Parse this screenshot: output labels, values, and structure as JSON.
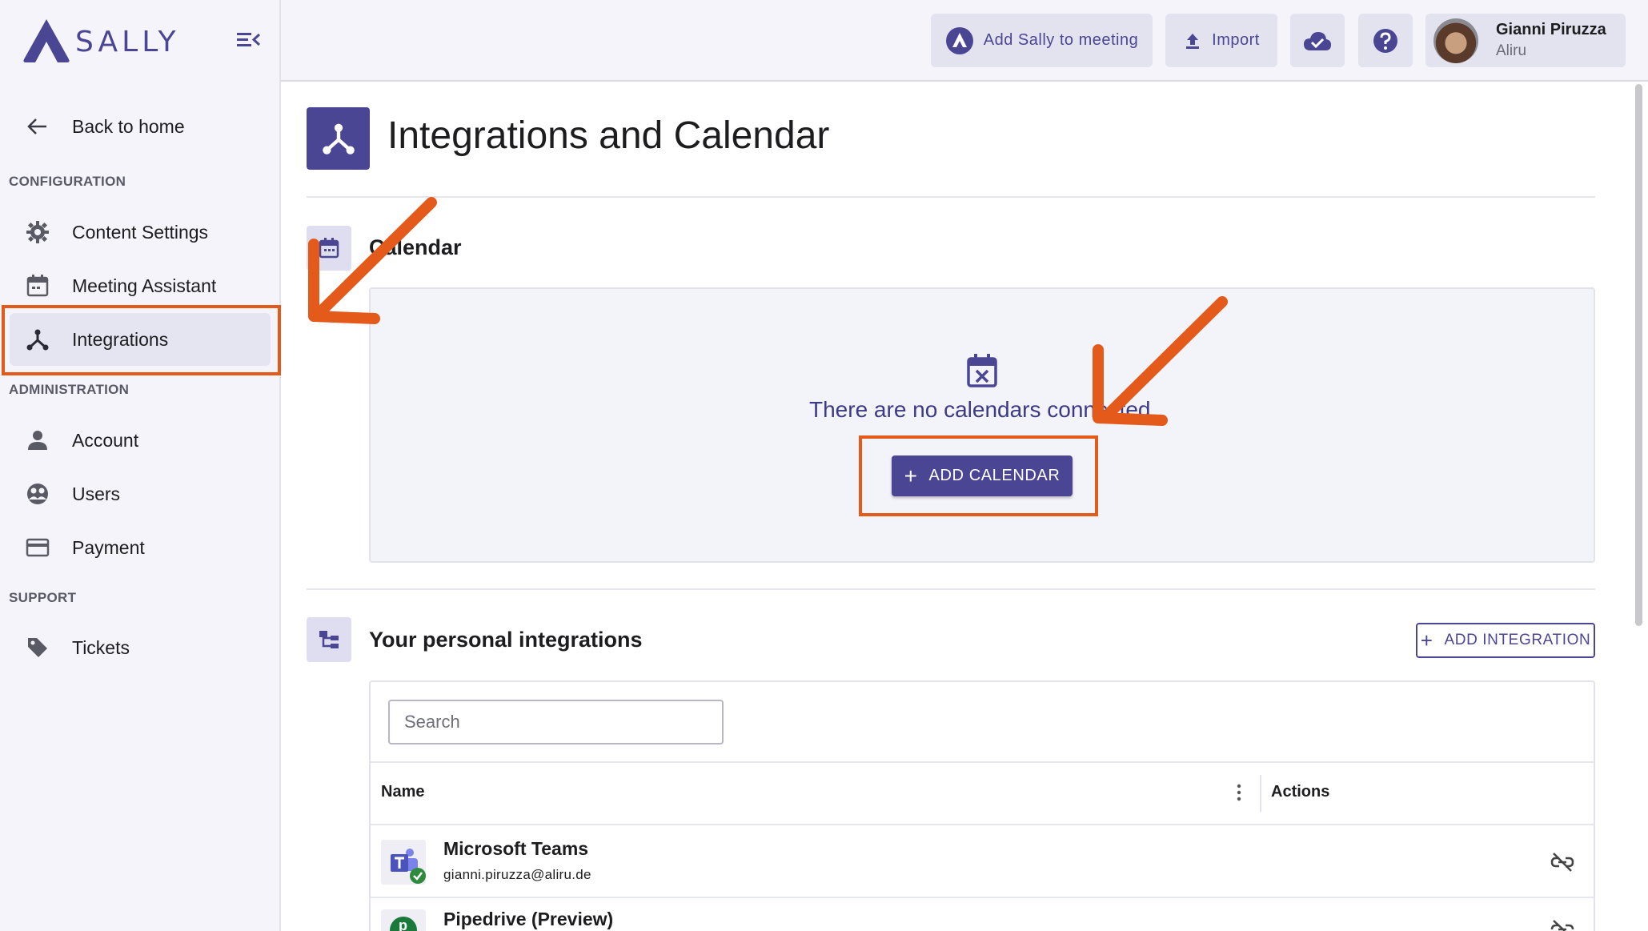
{
  "sidebar": {
    "brand": "SALLY",
    "back_label": "Back to home",
    "sections": {
      "configuration": "CONFIGURATION",
      "administration": "ADMINISTRATION",
      "support": "SUPPORT"
    },
    "items": [
      {
        "label": "Content Settings",
        "icon": "gear-icon"
      },
      {
        "label": "Meeting Assistant",
        "icon": "calendar-icon"
      },
      {
        "label": "Integrations",
        "icon": "integrations-icon",
        "active": true
      },
      {
        "label": "Account",
        "icon": "person-icon"
      },
      {
        "label": "Users",
        "icon": "users-icon"
      },
      {
        "label": "Payment",
        "icon": "card-icon"
      },
      {
        "label": "Tickets",
        "icon": "tag-icon"
      }
    ]
  },
  "topbar": {
    "add_sally": "Add Sally to meeting",
    "import": "Import",
    "user": {
      "name": "Gianni Piruzza",
      "org": "Aliru"
    }
  },
  "page": {
    "title": "Integrations and Calendar",
    "calendar": {
      "title": "Calendar",
      "empty_text": "There are no calendars connected",
      "add_button": "ADD CALENDAR"
    },
    "integrations": {
      "title": "Your personal integrations",
      "add_button": "ADD INTEGRATION",
      "search_placeholder": "Search",
      "columns": {
        "name": "Name",
        "actions": "Actions"
      },
      "rows": [
        {
          "name": "Microsoft Teams",
          "email": "gianni.piruzza@aliru.de"
        },
        {
          "name": "Pipedrive (Preview)",
          "email": ""
        }
      ]
    }
  },
  "colors": {
    "brand": "#4a4694",
    "annotation": "#e35a1a",
    "success": "#2e8b3e"
  }
}
